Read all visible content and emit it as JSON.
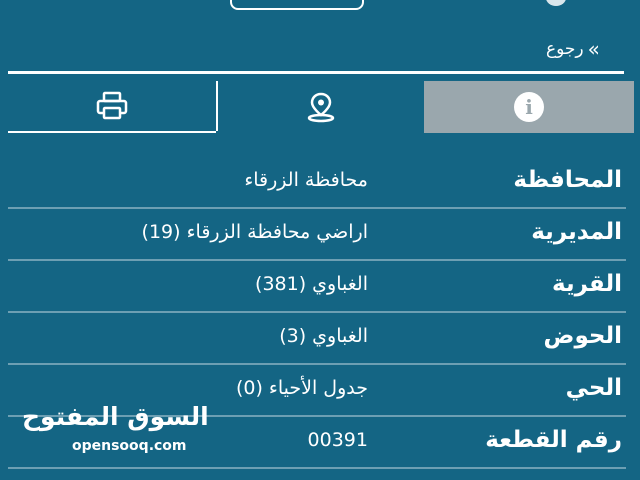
{
  "header": {
    "back_label": "رجوع",
    "back_icon": "double-chevron-right"
  },
  "tabs": [
    {
      "id": "print",
      "icon": "printer-icon",
      "active": false
    },
    {
      "id": "location",
      "icon": "map-pin-icon",
      "active": false
    },
    {
      "id": "info",
      "icon": "info-icon",
      "active": true,
      "glyph": "i"
    }
  ],
  "details": [
    {
      "label": "المحافظة",
      "value": "محافظة الزرقاء"
    },
    {
      "label": "المديرية",
      "value": "اراضي محافظة الزرقاء (19)"
    },
    {
      "label": "القرية",
      "value": "الغباوي (381)"
    },
    {
      "label": "الحوض",
      "value": "الغباوي (3)"
    },
    {
      "label": "الحي",
      "value": "جدول الأحياء (0)"
    },
    {
      "label": "رقم القطعة",
      "value": "00391"
    }
  ],
  "watermark": {
    "arabic": "السوق المفتوح",
    "latin": "opensooq.com"
  },
  "colors": {
    "background": "#146584",
    "active_tab": "#9aa7ad",
    "row_divider": "#6d9fb3",
    "text": "#ffffff"
  }
}
